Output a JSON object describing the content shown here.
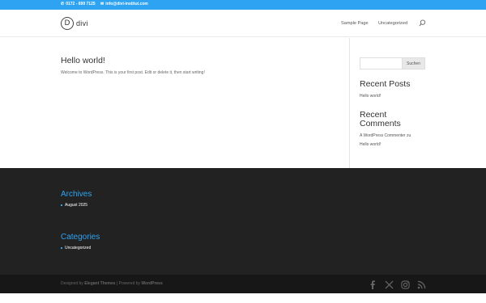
{
  "colors": {
    "accent": "#2ea3f2",
    "footer_bg": "#222222",
    "bottom_bar_bg": "#171717"
  },
  "top_bar": {
    "phone_icon": "phone-icon",
    "phone": "0172 - 699 7125",
    "email_icon": "envelope-icon",
    "email": "info@divi-institut.com"
  },
  "header": {
    "logo_mark": "D",
    "logo_text": "divi",
    "nav": [
      "Sample Page",
      "Uncategorized"
    ],
    "search_icon": "search-icon"
  },
  "post": {
    "title": "Hello world!",
    "excerpt": "Welcome to WordPress. This is your first post. Edit or delete it, then start writing!"
  },
  "sidebar": {
    "search_placeholder": "",
    "search_button": "Suchen",
    "recent_posts_title": "Recent Posts",
    "recent_posts": [
      "Hello world!"
    ],
    "recent_comments_title_1": "Recent",
    "recent_comments_title_2": "Comments",
    "comment_author": "A WordPress Commenter",
    "comment_on": "zu",
    "comment_post": "Hello world!"
  },
  "footer": {
    "archives_title": "Archives",
    "archives": [
      "August 2025"
    ],
    "categories_title": "Categories",
    "categories": [
      "Uncategorized"
    ]
  },
  "bottom_bar": {
    "designed_by": "Designed by",
    "elegant_themes": "Elegant Themes",
    "separator": "| Powered by",
    "wordpress": "WordPress",
    "social_icons": [
      "facebook-icon",
      "x-icon",
      "instagram-icon",
      "rss-icon"
    ]
  }
}
